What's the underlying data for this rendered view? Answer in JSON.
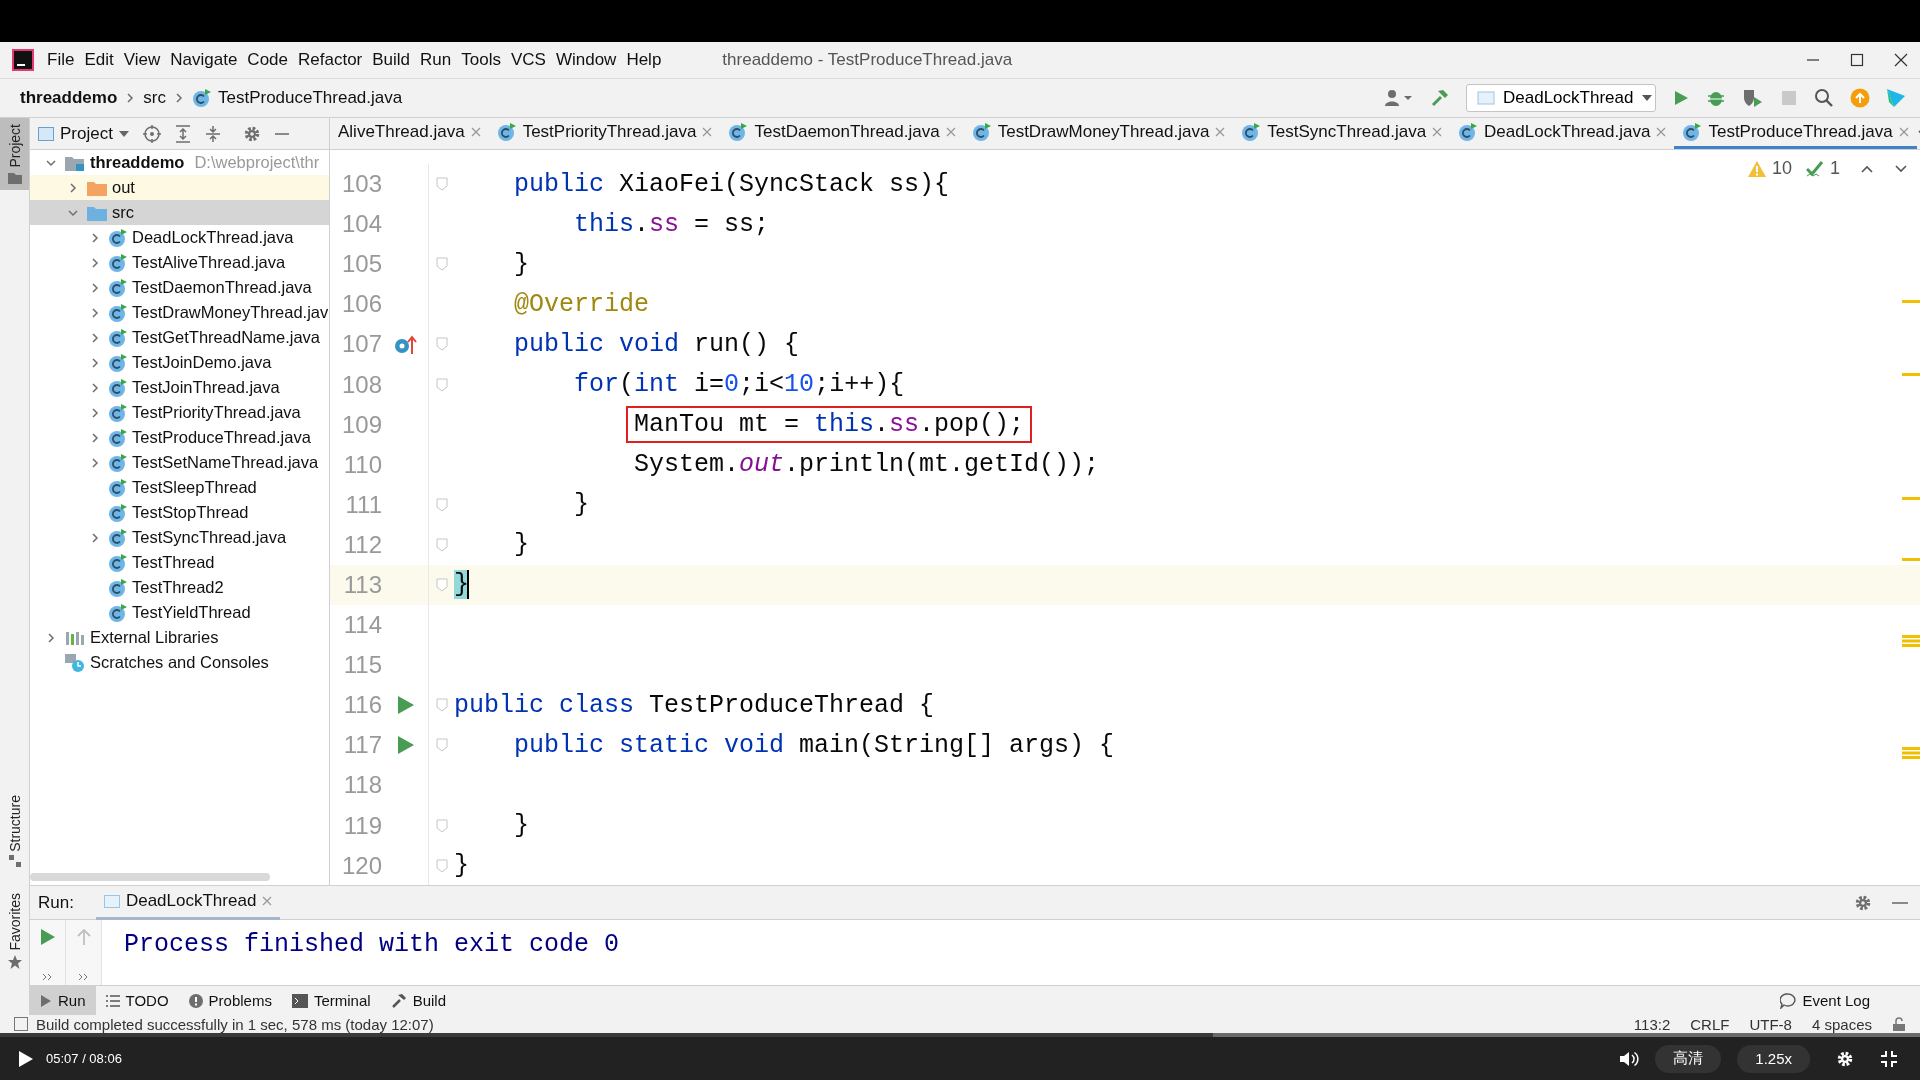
{
  "title_bar": {
    "menus": [
      "File",
      "Edit",
      "View",
      "Navigate",
      "Code",
      "Refactor",
      "Build",
      "Run",
      "Tools",
      "VCS",
      "Window",
      "Help"
    ],
    "title": "threaddemo - TestProduceThread.java"
  },
  "nav_bar": {
    "breadcrumb": [
      {
        "label": "threaddemo",
        "kind": "module"
      },
      {
        "label": "src",
        "kind": "folder"
      },
      {
        "label": "TestProduceThread.java",
        "kind": "class"
      }
    ],
    "run_config": "DeadLockThread"
  },
  "side_strip": {
    "top": [
      {
        "label": "Project",
        "selected": true
      }
    ],
    "bottom": [
      {
        "label": "Structure",
        "selected": false
      },
      {
        "label": "Favorites",
        "selected": false
      }
    ]
  },
  "project": {
    "header": "Project",
    "tree": [
      {
        "label": "threaddemo",
        "path": "D:\\webproject\\thr",
        "kind": "module",
        "expandable": true,
        "expanded": true,
        "selected": false,
        "children": [
          {
            "label": "out",
            "kind": "excluded_folder",
            "expandable": true,
            "expanded": false,
            "selected": false
          },
          {
            "label": "src",
            "kind": "source_folder",
            "expandable": true,
            "expanded": true,
            "selected": true,
            "children": [
              {
                "label": "DeadLockThread.java",
                "kind": "class",
                "expandable": true,
                "expanded": false,
                "selected": false
              },
              {
                "label": "TestAliveThread.java",
                "kind": "class",
                "expandable": true,
                "expanded": false,
                "selected": false
              },
              {
                "label": "TestDaemonThread.java",
                "kind": "class",
                "expandable": true,
                "expanded": false,
                "selected": false
              },
              {
                "label": "TestDrawMoneyThread.jav",
                "kind": "class",
                "expandable": true,
                "expanded": false,
                "selected": false
              },
              {
                "label": "TestGetThreadName.java",
                "kind": "class",
                "expandable": true,
                "expanded": false,
                "selected": false
              },
              {
                "label": "TestJoinDemo.java",
                "kind": "class",
                "expandable": true,
                "expanded": false,
                "selected": false
              },
              {
                "label": "TestJoinThread.java",
                "kind": "class",
                "expandable": true,
                "expanded": false,
                "selected": false
              },
              {
                "label": "TestPriorityThread.java",
                "kind": "class",
                "expandable": true,
                "expanded": false,
                "selected": false
              },
              {
                "label": "TestProduceThread.java",
                "kind": "class",
                "expandable": true,
                "expanded": false,
                "selected": false
              },
              {
                "label": "TestSetNameThread.java",
                "kind": "class",
                "expandable": true,
                "expanded": false,
                "selected": false
              },
              {
                "label": "TestSleepThread",
                "kind": "class",
                "expandable": false,
                "selected": false
              },
              {
                "label": "TestStopThread",
                "kind": "class",
                "expandable": false,
                "selected": false
              },
              {
                "label": "TestSyncThread.java",
                "kind": "class",
                "expandable": true,
                "expanded": false,
                "selected": false
              },
              {
                "label": "TestThread",
                "kind": "class",
                "expandable": false,
                "selected": false
              },
              {
                "label": "TestThread2",
                "kind": "class",
                "expandable": false,
                "selected": false
              },
              {
                "label": "TestYieldThread",
                "kind": "class",
                "expandable": false,
                "selected": false
              }
            ]
          }
        ]
      },
      {
        "label": "External Libraries",
        "kind": "libraries",
        "expandable": true,
        "expanded": false,
        "selected": false
      },
      {
        "label": "Scratches and Consoles",
        "kind": "scratches",
        "expandable": false,
        "selected": false
      }
    ]
  },
  "tabs": [
    {
      "label": "AliveThread.java",
      "icon": false,
      "selected": false
    },
    {
      "label": "TestPriorityThread.java",
      "icon": true,
      "selected": false
    },
    {
      "label": "TestDaemonThread.java",
      "icon": true,
      "selected": false
    },
    {
      "label": "TestDrawMoneyThread.java",
      "icon": true,
      "selected": false
    },
    {
      "label": "TestSyncThread.java",
      "icon": true,
      "selected": false
    },
    {
      "label": "DeadLockThread.java",
      "icon": true,
      "selected": false
    },
    {
      "label": "TestProduceThread.java",
      "icon": true,
      "selected": true
    }
  ],
  "editor": {
    "warnings": "10",
    "weak_warnings": "1",
    "lines": [
      {
        "number": "103",
        "kind": "plain",
        "fold": true,
        "current": false,
        "boxed": false,
        "tokens": [
          {
            "kind": "kw",
            "text": "    public"
          },
          {
            "kind": "plain",
            "text": " XiaoFei(SyncStack ss){"
          }
        ]
      },
      {
        "number": "104",
        "kind": "plain",
        "fold": false,
        "current": false,
        "boxed": false,
        "tokens": [
          {
            "kind": "kw",
            "text": "        this"
          },
          {
            "kind": "plain",
            "text": "."
          },
          {
            "kind": "field",
            "text": "ss"
          },
          {
            "kind": "plain",
            "text": " = ss;"
          }
        ]
      },
      {
        "number": "105",
        "kind": "plain",
        "fold": true,
        "current": false,
        "boxed": false,
        "tokens": [
          {
            "kind": "plain",
            "text": "    }"
          }
        ]
      },
      {
        "number": "106",
        "kind": "plain",
        "fold": false,
        "current": false,
        "boxed": false,
        "tokens": [
          {
            "kind": "anno",
            "text": "    @Override"
          }
        ]
      },
      {
        "number": "107",
        "kind": "override",
        "fold": true,
        "current": false,
        "boxed": false,
        "tokens": [
          {
            "kind": "kw",
            "text": "    public void"
          },
          {
            "kind": "plain",
            "text": " run() {"
          }
        ]
      },
      {
        "number": "108",
        "kind": "plain",
        "fold": true,
        "current": false,
        "boxed": false,
        "tokens": [
          {
            "kind": "kw",
            "text": "        for"
          },
          {
            "kind": "plain",
            "text": "("
          },
          {
            "kind": "kw",
            "text": "int"
          },
          {
            "kind": "plain",
            "text": " i="
          },
          {
            "kind": "num",
            "text": "0"
          },
          {
            "kind": "plain",
            "text": ";i<"
          },
          {
            "kind": "num",
            "text": "10"
          },
          {
            "kind": "plain",
            "text": ";i++){"
          }
        ]
      },
      {
        "number": "109",
        "kind": "plain",
        "fold": false,
        "current": false,
        "boxed": true,
        "tokens": [
          {
            "kind": "plain",
            "text": "            ManTou mt = "
          },
          {
            "kind": "kw",
            "text": "this"
          },
          {
            "kind": "plain",
            "text": "."
          },
          {
            "kind": "field",
            "text": "ss"
          },
          {
            "kind": "plain",
            "text": ".pop();"
          }
        ]
      },
      {
        "number": "110",
        "kind": "plain",
        "fold": false,
        "current": false,
        "boxed": false,
        "tokens": [
          {
            "kind": "plain",
            "text": "            System."
          },
          {
            "kind": "static",
            "text": "out"
          },
          {
            "kind": "plain",
            "text": ".println(mt.getId());"
          }
        ]
      },
      {
        "number": "111",
        "kind": "plain",
        "fold": true,
        "current": false,
        "boxed": false,
        "tokens": [
          {
            "kind": "plain",
            "text": "        }"
          }
        ]
      },
      {
        "number": "112",
        "kind": "plain",
        "fold": true,
        "current": false,
        "boxed": false,
        "tokens": [
          {
            "kind": "plain",
            "text": "    }"
          }
        ]
      },
      {
        "number": "113",
        "kind": "plain",
        "fold": true,
        "current": true,
        "boxed": false,
        "tokens": [
          {
            "kind": "brace",
            "text": "}"
          }
        ]
      },
      {
        "number": "114",
        "kind": "plain",
        "fold": false,
        "current": false,
        "boxed": false
      },
      {
        "number": "115",
        "kind": "plain",
        "fold": false,
        "current": false,
        "boxed": false
      },
      {
        "number": "116",
        "kind": "run",
        "fold": true,
        "current": false,
        "boxed": false,
        "tokens": [
          {
            "kind": "kw",
            "text": "public class"
          },
          {
            "kind": "plain",
            "text": " TestProduceThread {"
          }
        ]
      },
      {
        "number": "117",
        "kind": "run",
        "fold": true,
        "current": false,
        "boxed": false,
        "tokens": [
          {
            "kind": "kw",
            "text": "    public static void"
          },
          {
            "kind": "plain",
            "text": " main(String[] args) {"
          }
        ]
      },
      {
        "number": "118",
        "kind": "plain",
        "fold": false,
        "current": false,
        "boxed": false
      },
      {
        "number": "119",
        "kind": "plain",
        "fold": true,
        "current": false,
        "boxed": false,
        "tokens": [
          {
            "kind": "plain",
            "text": "    }"
          }
        ]
      },
      {
        "number": "120",
        "kind": "plain",
        "fold": true,
        "current": false,
        "boxed": false,
        "tokens": [
          {
            "kind": "plain",
            "text": "}"
          }
        ]
      }
    ]
  },
  "run": {
    "label": "Run:",
    "tab": "DeadLockThread",
    "output": "Process finished with exit code 0"
  },
  "tool_strip": {
    "items": [
      {
        "label": "Run",
        "kind": "run",
        "selected": true
      },
      {
        "label": "TODO",
        "kind": "todo",
        "selected": false
      },
      {
        "label": "Problems",
        "kind": "problems",
        "selected": false
      },
      {
        "label": "Terminal",
        "kind": "terminal",
        "selected": false
      },
      {
        "label": "Build",
        "kind": "build",
        "selected": false
      }
    ],
    "event_log": "Event Log"
  },
  "status_bar": {
    "message": "Build completed successfully in 1 sec, 578 ms (today 12:07)",
    "position": "113:2",
    "line_separator": "CRLF",
    "encoding": "UTF-8",
    "indent": "4 spaces"
  },
  "video": {
    "time": "05:07 / 08:06",
    "level": 0.632,
    "quality": "高清",
    "speed": "1.25x"
  }
}
